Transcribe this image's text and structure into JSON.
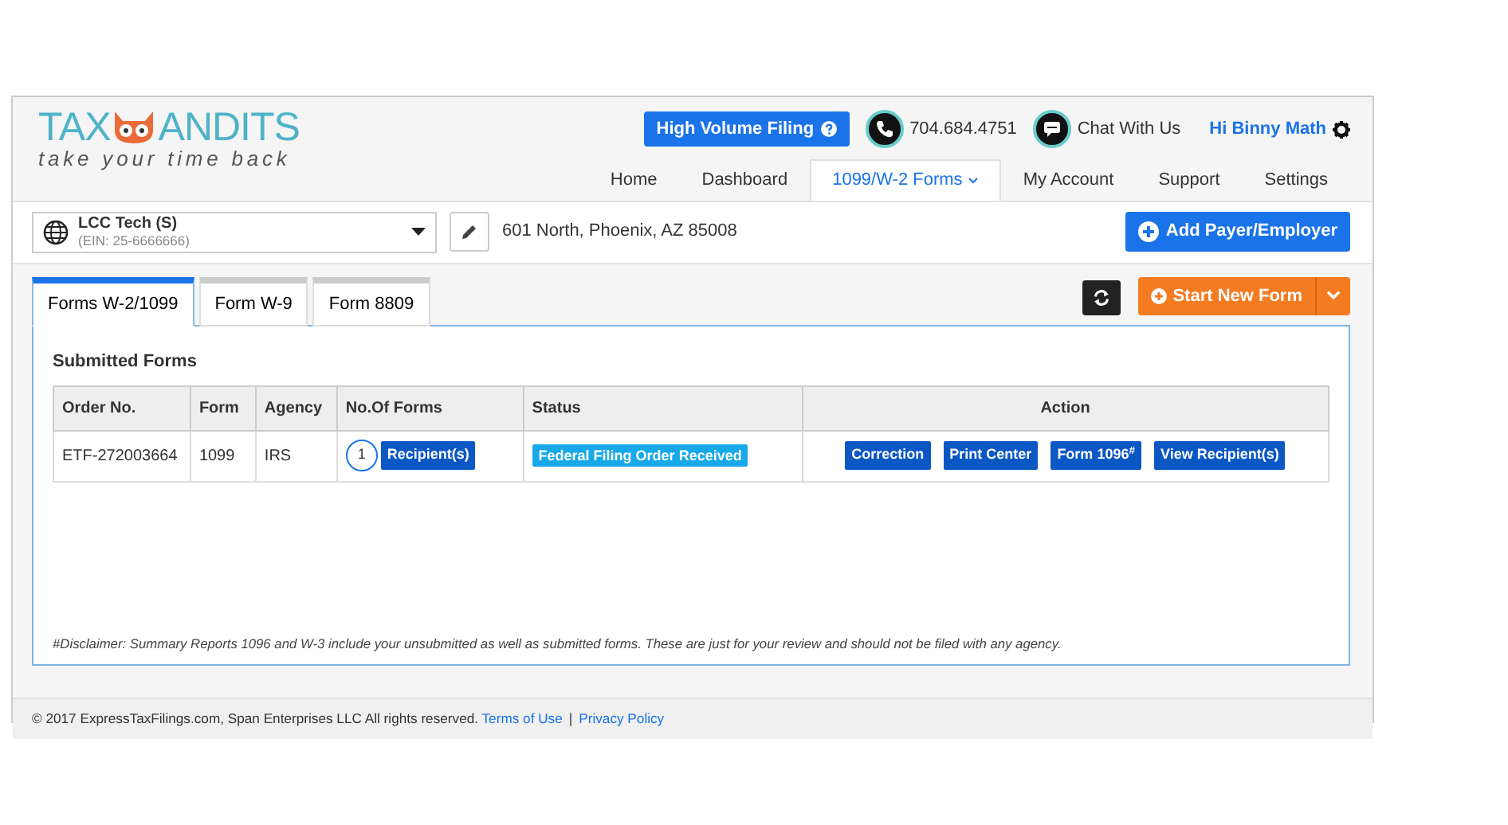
{
  "logo": {
    "left": "TAX",
    "right": "ANDITS",
    "tagline": "take your time back"
  },
  "header": {
    "high_volume_button": "High Volume Filing",
    "phone": "704.684.4751",
    "chat": "Chat With Us",
    "user": "Hi Binny Math"
  },
  "nav": [
    {
      "label": "Home",
      "selected": false,
      "has_menu": false
    },
    {
      "label": "Dashboard",
      "selected": false,
      "has_menu": false
    },
    {
      "label": "1099/W-2 Forms",
      "selected": true,
      "has_menu": true
    },
    {
      "label": "My Account",
      "selected": false,
      "has_menu": false
    },
    {
      "label": "Support",
      "selected": false,
      "has_menu": false
    },
    {
      "label": "Settings",
      "selected": false,
      "has_menu": false
    }
  ],
  "payer": {
    "name": "LCC Tech (S)",
    "ein": "(EIN: 25-6666666)",
    "address": "601 North, Phoenix, AZ 85008",
    "add_button": "Add Payer/Employer"
  },
  "tabs": [
    {
      "label": "Forms W-2/1099",
      "selected": true
    },
    {
      "label": "Form W-9",
      "selected": false
    },
    {
      "label": "Form 8809",
      "selected": false
    }
  ],
  "start_new_form": "Start New Form",
  "section_title": "Submitted Forms",
  "table": {
    "columns": [
      "Order No.",
      "Form",
      "Agency",
      "No.Of Forms",
      "Status",
      "Action"
    ],
    "rows": [
      {
        "order_no": "ETF-272003664",
        "form": "1099",
        "agency": "IRS",
        "count": "1",
        "count_button": "Recipient(s)",
        "status": "Federal Filing Order Received",
        "actions": [
          "Correction",
          "Print Center",
          "Form 1096$^{#}$",
          "View Recipient(s)"
        ]
      }
    ]
  },
  "disclaimer": "#Disclaimer: Summary Reports 1096 and W-3 include your unsubmitted as well as submitted forms. These are just for your review and should not be filed with any agency.",
  "footer": {
    "copyright": "© 2017 ExpressTaxFilings.com, Span Enterprises LLC All rights reserved.",
    "links": [
      "Terms of Use",
      "Privacy Policy"
    ],
    "separator": "|"
  }
}
